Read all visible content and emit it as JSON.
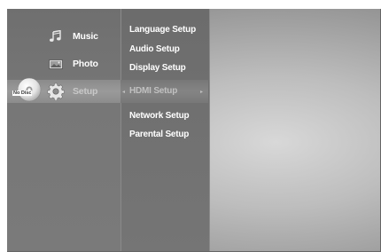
{
  "disc": {
    "label": "No Disc"
  },
  "main_menu": {
    "items": [
      {
        "label": "Music",
        "icon": "music-note-icon"
      },
      {
        "label": "Photo",
        "icon": "photo-icon"
      },
      {
        "label": "Setup",
        "icon": "gear-icon"
      }
    ]
  },
  "setup_menu": {
    "items": [
      {
        "label": "Language Setup"
      },
      {
        "label": "Audio Setup"
      },
      {
        "label": "Display Setup"
      },
      {
        "label": "HDMI Setup"
      },
      {
        "label": "Network Setup"
      },
      {
        "label": "Parental Setup"
      }
    ],
    "left_arrow": "◂",
    "right_arrow": "▸"
  }
}
